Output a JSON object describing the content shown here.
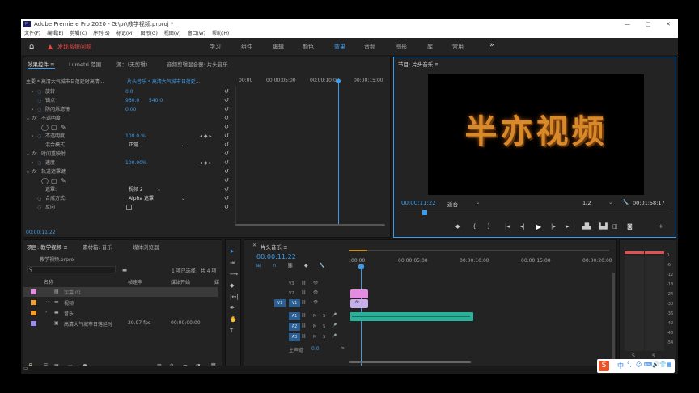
{
  "window": {
    "title": "Adobe Premiere Pro 2020 - G:\\pr\\教学视频.prproj *",
    "controls": [
      "—",
      "▢",
      "✕"
    ]
  },
  "menu": [
    "文件(F)",
    "编辑(E)",
    "剪辑(C)",
    "序列(S)",
    "标记(M)",
    "图形(G)",
    "视图(V)",
    "窗口(W)",
    "帮助(H)"
  ],
  "topbar": {
    "alert": "发现系统问题",
    "workspaces": [
      "学习",
      "组件",
      "编辑",
      "颜色",
      "效果",
      "音频",
      "图形",
      "库",
      "常用"
    ],
    "active": "效果",
    "more": "»"
  },
  "effect_controls": {
    "tabs": [
      "效果控件 ≡",
      "Lumetri 范围",
      "源：（无剪辑）",
      "音频剪辑混合器: 片头音乐"
    ],
    "source": "主要 * 高清大气城市日落延时高清...",
    "clip": "片头音乐 * 高清大气城市日落延...",
    "ruler": [
      "00:00",
      "00:00:05:00",
      "00:00:10:00",
      "00:00:15:00"
    ],
    "rows": [
      {
        "label": "旋转",
        "value": "0.0"
      },
      {
        "label": "锚点",
        "value": "960.0",
        "value2": "540.0"
      },
      {
        "label": "防闪烁滤镜",
        "value": "0.00"
      },
      {
        "label": "不透明度",
        "value": ""
      },
      {
        "label": "不透明度",
        "value": "100.0 %"
      },
      {
        "label": "混合模式",
        "value": "正常"
      },
      {
        "label": "时间重映射",
        "value": ""
      },
      {
        "label": "速度",
        "value": "100.00%"
      },
      {
        "label": "轨道遮罩键",
        "value": ""
      },
      {
        "label": "遮罩:",
        "value": "视频 2"
      },
      {
        "label": "合成方式:",
        "value": "Alpha 遮罩"
      },
      {
        "label": "反向",
        "value": ""
      }
    ],
    "fx_label": "fx",
    "timecode": "00:00:11:22"
  },
  "program": {
    "tab": "节目: 片头音乐 ≡",
    "title_text": "半亦视频",
    "timecode": "00:00:11:22",
    "fit": "适合",
    "ratio": "1/2",
    "duration": "00:01:58:17"
  },
  "project": {
    "tabs": [
      "项目: 教学视频 ≡",
      "素材箱: 音乐",
      "媒体浏览器"
    ],
    "file": "教学视频.prproj",
    "selection": "1 项已选择，共 4 项",
    "columns": [
      "名称",
      "帧速率",
      "媒体开始",
      "媒"
    ],
    "items": [
      {
        "name": "字幕 01",
        "fps": "",
        "start": ""
      },
      {
        "name": "视频",
        "fps": "",
        "start": ""
      },
      {
        "name": "音乐",
        "fps": "",
        "start": ""
      },
      {
        "name": "高清大气城市日落延时",
        "fps": "29.97 fps",
        "start": "00:00:00:00"
      }
    ]
  },
  "timeline": {
    "tab": "片头音乐 ≡",
    "timecode": "00:00:11:22",
    "ruler": [
      ":00:00",
      "00:00:05:00",
      "00:00:10:00",
      "00:00:15:00",
      "00:00:20:00"
    ],
    "video_tracks": [
      "V3",
      "V2",
      "V1"
    ],
    "audio_tracks": [
      "A1",
      "A2",
      "A3"
    ],
    "master": "主声道",
    "master_value": "0.0",
    "clip_label": "fx"
  },
  "meter": {
    "scale": [
      "0",
      "-6",
      "-12",
      "-18",
      "-24",
      "-30",
      "-36",
      "-42",
      "-48",
      "-54"
    ],
    "s_labels": [
      "S",
      "S"
    ]
  },
  "taskbar": {
    "logo": "S",
    "icons": [
      "中",
      "°,",
      "☺",
      "⌨",
      "🔊",
      "👕",
      "✂",
      "▦"
    ]
  }
}
